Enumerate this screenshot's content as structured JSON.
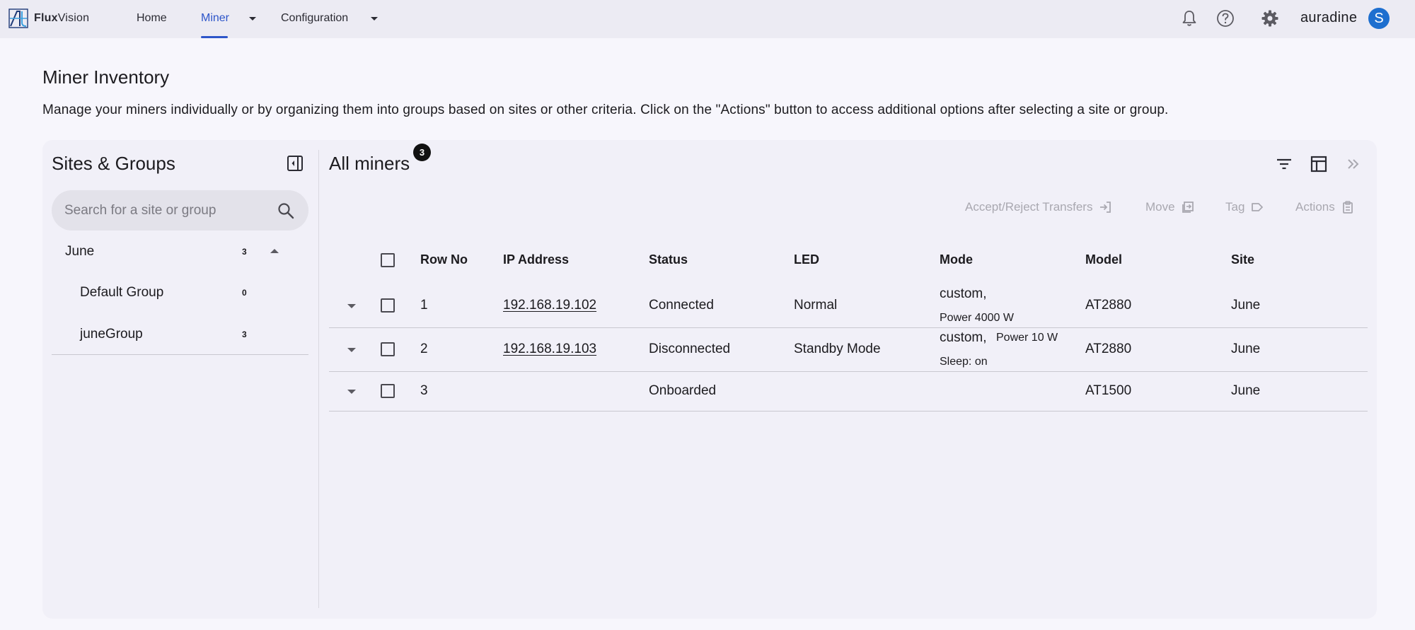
{
  "app": {
    "logo_text_bold": "Flux",
    "logo_text_rest": "Vision",
    "brand": "auradine",
    "avatar_initial": "S"
  },
  "nav": {
    "home": "Home",
    "miner": "Miner",
    "configuration": "Configuration"
  },
  "page": {
    "title": "Miner Inventory",
    "description": "Manage your miners individually or by organizing them into groups based on sites or other criteria. Click on the \"Actions\" button to access additional options after selecting a site or group."
  },
  "sidebar": {
    "title": "Sites & Groups",
    "search_placeholder": "Search for a site or group",
    "site": {
      "label": "June",
      "count": "3"
    },
    "groups": [
      {
        "label": "Default Group",
        "count": "0"
      },
      {
        "label": "juneGroup",
        "count": "3"
      }
    ]
  },
  "main": {
    "title": "All miners",
    "badge": "3",
    "actions": {
      "accept_reject": "Accept/Reject Transfers",
      "move": "Move",
      "tag": "Tag",
      "actions": "Actions"
    }
  },
  "table": {
    "headers": [
      "Row No",
      "IP Address",
      "Status",
      "LED",
      "Mode",
      "Model",
      "Site"
    ],
    "rows": [
      {
        "row_no": "1",
        "ip": "192.168.19.102",
        "status": "Connected",
        "led": "Normal",
        "mode_line1": "custom,",
        "mode_line2": "Power 4000 W",
        "model": "AT2880",
        "site": "June"
      },
      {
        "row_no": "2",
        "ip": "192.168.19.103",
        "status": "Disconnected",
        "led": "Standby Mode",
        "mode_line1": "custom,",
        "mode_power": "Power 10 W",
        "mode_line2": "Sleep: on",
        "model": "AT2880",
        "site": "June"
      },
      {
        "row_no": "3",
        "ip": "",
        "status": "Onboarded",
        "led": "",
        "mode_line1": "",
        "mode_line2": "",
        "model": "AT1500",
        "site": "June"
      }
    ]
  },
  "colors": {
    "accent": "#2d55c9",
    "avatar": "#1e6fcf",
    "badge": "#111111"
  },
  "icons": [
    "logo-mark",
    "bell-icon",
    "help-icon",
    "gear-icon",
    "collapse-panel-icon",
    "search-icon",
    "filter-icon",
    "columns-icon",
    "double-chevron-right-icon",
    "accept-transfer-icon",
    "move-icon",
    "tag-icon",
    "clipboard-icon",
    "chevron-down-icon",
    "chevron-up-icon",
    "checkbox-icon"
  ]
}
